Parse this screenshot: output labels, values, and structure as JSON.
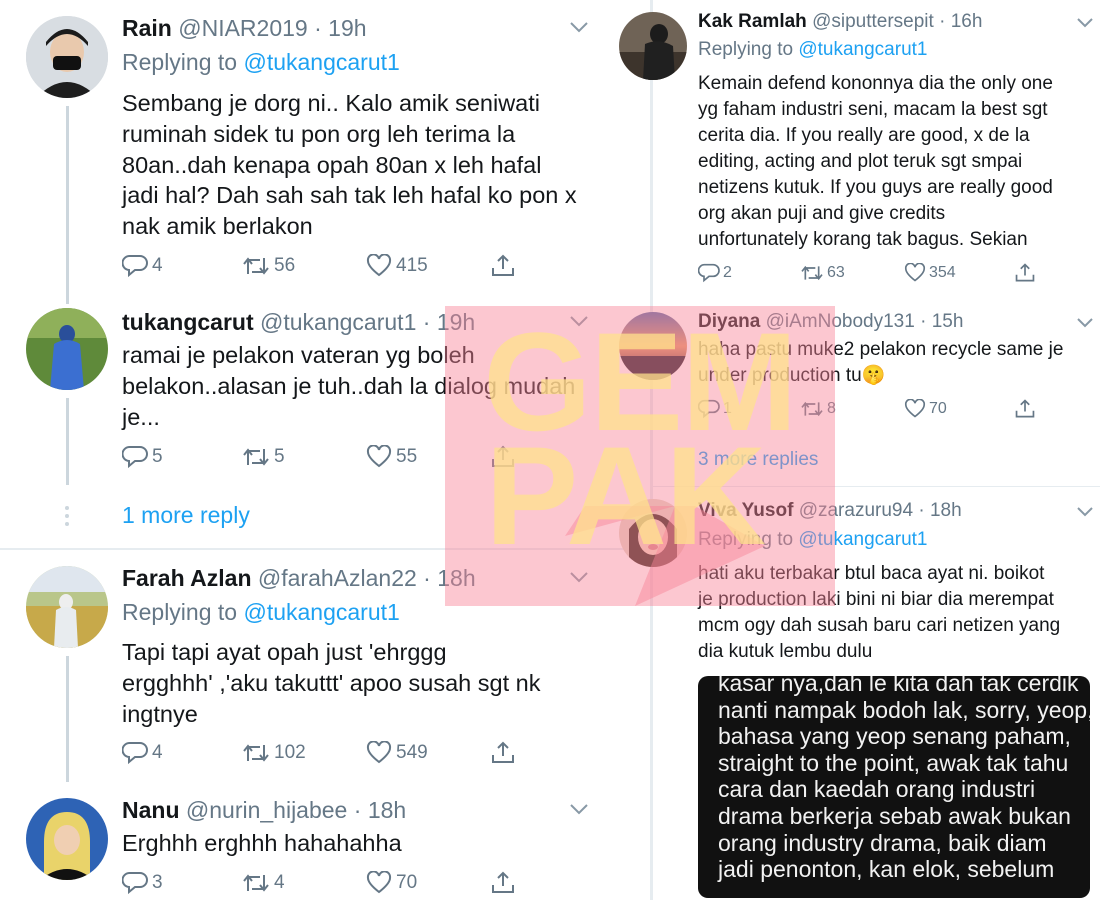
{
  "watermark": {
    "line1": "GEM",
    "line2": "PAK"
  },
  "left_tweets": [
    {
      "name": "Rain",
      "handle": "@NIAR2019",
      "time": "19h",
      "replying_label": "Replying to",
      "replying_to": "@tukangcarut1",
      "lines": [
        "Sembang je dorg ni.. Kalo amik seniwati",
        "ruminah sidek tu pon org leh terima la",
        "80an..dah kenapa opah 80an x leh hafal",
        "jadi hal? Dah sah sah tak leh hafal ko pon x",
        "nak amik berlakon"
      ],
      "replies": "4",
      "retweets": "56",
      "likes": "415"
    },
    {
      "name": "tukangcarut",
      "handle": "@tukangcarut1",
      "time": "19h",
      "lines": [
        "ramai je pelakon vateran yg boleh",
        "belakon..alasan je tuh..dah la dialog mudah",
        "je..."
      ],
      "replies": "5",
      "retweets": "5",
      "likes": "55"
    },
    {
      "name": "Farah Azlan",
      "handle": "@farahAzlan22",
      "time": "18h",
      "replying_label": "Replying to",
      "replying_to": "@tukangcarut1",
      "lines": [
        "Tapi tapi ayat opah just 'ehrggg",
        "ergghhh' ,'aku takuttt' apoo susah sgt nk",
        "ingtnye"
      ],
      "replies": "4",
      "retweets": "102",
      "likes": "549"
    },
    {
      "name": "Nanu",
      "handle": "@nurin_hijabee",
      "time": "18h",
      "lines": [
        "Erghhh erghhh hahahahha"
      ],
      "replies": "3",
      "retweets": "4",
      "likes": "70"
    }
  ],
  "left_more_reply": "1 more reply",
  "right_tweets": [
    {
      "name": "Kak Ramlah",
      "handle": "@siputtersepit",
      "time": "16h",
      "replying_label": "Replying to",
      "replying_to": "@tukangcarut1",
      "lines": [
        "Kemain defend kononnya dia the only one",
        "yg faham industri seni, macam la best sgt",
        "cerita dia. If you really are good, x de la",
        "editing, acting and plot teruk sgt smpai",
        "netizens kutuk. If you guys are really good",
        "org akan puji and give credits",
        "unfortunately korang tak bagus. Sekian"
      ],
      "replies": "2",
      "retweets": "63",
      "likes": "354"
    },
    {
      "name": "Diyana",
      "handle": "@iAmNobody131",
      "time": "15h",
      "lines": [
        "haha pastu muke2 pelakon recycle same je",
        "under production tu"
      ],
      "emoji": "🤫",
      "replies": "1",
      "retweets": "8",
      "likes": "70"
    },
    {
      "name": "Viva Yusof",
      "handle": "@zarazuru94",
      "time": "18h",
      "replying_label": "Replying to",
      "replying_to": "@tukangcarut1",
      "lines": [
        "hati aku terbakar btul baca ayat ni. boikot",
        "je production laki bini ni biar dia merempat",
        "mcm ogy dah susah baru cari netizen yang",
        "dia kutuk lembu dulu"
      ]
    }
  ],
  "right_more_replies": "3 more replies",
  "embedded_screenshot": {
    "lines": [
      "kasar nya,dah le kita dah tak cerdik",
      "nanti nampak bodoh lak, sorry, yeop,",
      "bahasa yang yeop senang paham,",
      "straight to the point, awak tak tahu",
      "cara dan kaedah orang industri",
      "drama berkerja sebab awak bukan",
      "orang industry drama, baik diam",
      "jadi penonton, kan elok, sebelum"
    ]
  },
  "colors": {
    "link": "#1da1f2",
    "muted": "#657786",
    "text": "#14171a",
    "divider": "#e6ecf0",
    "thread": "#ccd6dd"
  }
}
